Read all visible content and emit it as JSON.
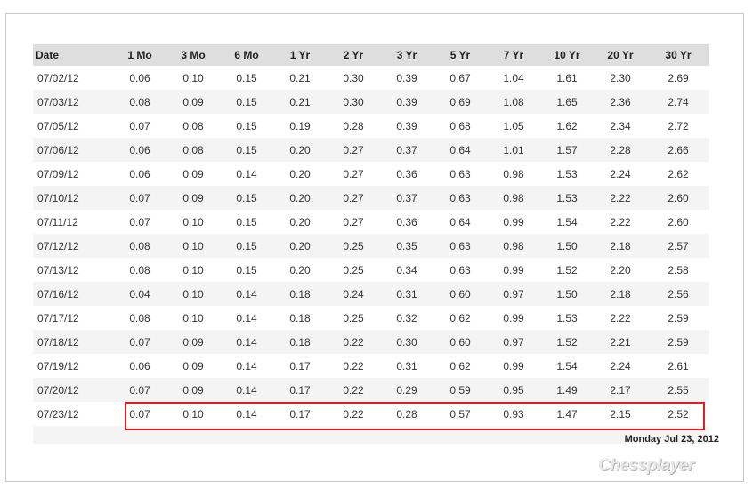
{
  "table": {
    "headers": [
      "Date",
      "1 Mo",
      "3 Mo",
      "6 Mo",
      "1 Yr",
      "2 Yr",
      "3 Yr",
      "5 Yr",
      "7 Yr",
      "10 Yr",
      "20 Yr",
      "30 Yr"
    ],
    "rows": [
      [
        "07/02/12",
        "0.06",
        "0.10",
        "0.15",
        "0.21",
        "0.30",
        "0.39",
        "0.67",
        "1.04",
        "1.61",
        "2.30",
        "2.69"
      ],
      [
        "07/03/12",
        "0.08",
        "0.09",
        "0.15",
        "0.21",
        "0.30",
        "0.39",
        "0.69",
        "1.08",
        "1.65",
        "2.36",
        "2.74"
      ],
      [
        "07/05/12",
        "0.07",
        "0.08",
        "0.15",
        "0.19",
        "0.28",
        "0.39",
        "0.68",
        "1.05",
        "1.62",
        "2.34",
        "2.72"
      ],
      [
        "07/06/12",
        "0.06",
        "0.08",
        "0.15",
        "0.20",
        "0.27",
        "0.37",
        "0.64",
        "1.01",
        "1.57",
        "2.28",
        "2.66"
      ],
      [
        "07/09/12",
        "0.06",
        "0.09",
        "0.14",
        "0.20",
        "0.27",
        "0.36",
        "0.63",
        "0.98",
        "1.53",
        "2.24",
        "2.62"
      ],
      [
        "07/10/12",
        "0.07",
        "0.09",
        "0.15",
        "0.20",
        "0.27",
        "0.37",
        "0.63",
        "0.98",
        "1.53",
        "2.22",
        "2.60"
      ],
      [
        "07/11/12",
        "0.07",
        "0.10",
        "0.15",
        "0.20",
        "0.27",
        "0.36",
        "0.64",
        "0.99",
        "1.54",
        "2.22",
        "2.60"
      ],
      [
        "07/12/12",
        "0.08",
        "0.10",
        "0.15",
        "0.20",
        "0.25",
        "0.35",
        "0.63",
        "0.98",
        "1.50",
        "2.18",
        "2.57"
      ],
      [
        "07/13/12",
        "0.08",
        "0.10",
        "0.15",
        "0.20",
        "0.25",
        "0.34",
        "0.63",
        "0.99",
        "1.52",
        "2.20",
        "2.58"
      ],
      [
        "07/16/12",
        "0.04",
        "0.10",
        "0.14",
        "0.18",
        "0.24",
        "0.31",
        "0.60",
        "0.97",
        "1.50",
        "2.18",
        "2.56"
      ],
      [
        "07/17/12",
        "0.08",
        "0.10",
        "0.14",
        "0.18",
        "0.25",
        "0.32",
        "0.62",
        "0.99",
        "1.53",
        "2.22",
        "2.59"
      ],
      [
        "07/18/12",
        "0.07",
        "0.09",
        "0.14",
        "0.18",
        "0.22",
        "0.30",
        "0.60",
        "0.97",
        "1.52",
        "2.21",
        "2.59"
      ],
      [
        "07/19/12",
        "0.06",
        "0.09",
        "0.14",
        "0.17",
        "0.22",
        "0.31",
        "0.62",
        "0.99",
        "1.54",
        "2.24",
        "2.61"
      ],
      [
        "07/20/12",
        "0.07",
        "0.09",
        "0.14",
        "0.17",
        "0.22",
        "0.29",
        "0.59",
        "0.95",
        "1.49",
        "2.17",
        "2.55"
      ],
      [
        "07/23/12",
        "0.07",
        "0.10",
        "0.14",
        "0.17",
        "0.22",
        "0.28",
        "0.57",
        "0.93",
        "1.47",
        "2.15",
        "2.52"
      ]
    ],
    "highlighted_row": "07/23/12"
  },
  "datestamp": "Monday Jul 23, 2012",
  "watermark": "Chessplayer",
  "colors": {
    "header_bg": "#dedede",
    "stripe_bg": "#f4f4f4",
    "highlight_border": "#e02020"
  }
}
